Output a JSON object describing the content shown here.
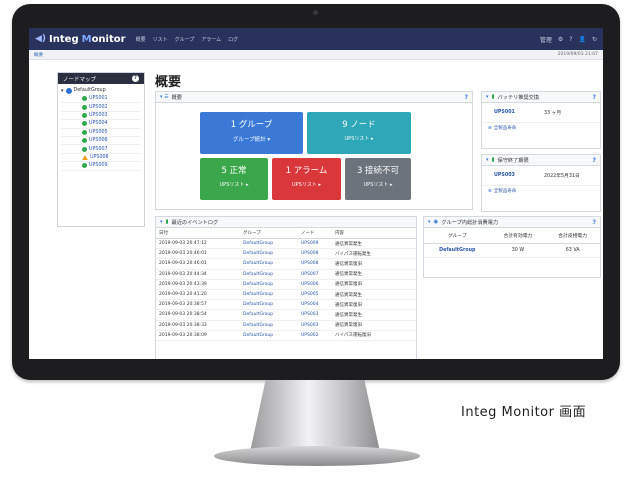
{
  "app": {
    "brand_prefix": "Integ ",
    "brand_m": "M",
    "brand_rest": "onitor"
  },
  "menu": [
    "概要",
    "リスト",
    "グループ",
    "アラーム",
    "ログ"
  ],
  "tools": [
    "管理",
    "⚙",
    "?",
    "👤",
    "↻"
  ],
  "breadcrumb": {
    "label": "概要",
    "timestamp": "2019/09/03 21:07"
  },
  "sidebar": {
    "title": "ノードマップ",
    "root": "DefaultGroup",
    "nodes": [
      {
        "name": "UPS001",
        "status": "ok"
      },
      {
        "name": "UPS002",
        "status": "ok"
      },
      {
        "name": "UPS003",
        "status": "ok"
      },
      {
        "name": "UPS004",
        "status": "ok"
      },
      {
        "name": "UPS005",
        "status": "ok"
      },
      {
        "name": "UPS006",
        "status": "ok"
      },
      {
        "name": "UPS007",
        "status": "ok"
      },
      {
        "name": "UPS008",
        "status": "warn"
      },
      {
        "name": "UPS009",
        "status": "ok"
      }
    ]
  },
  "page_title": "概要",
  "overview": {
    "title": "概要",
    "tiles": {
      "group": {
        "big": "1 グループ",
        "sub": "グループ統計 ▾",
        "color": "#3a7ad6"
      },
      "node": {
        "big": "9 ノード",
        "sub": "UPSリスト ▸",
        "color": "#2ea7b8"
      },
      "normal": {
        "big": "5 正常",
        "sub": "UPSリスト ▸",
        "color": "#3aa84a"
      },
      "alarm": {
        "big": "1 アラーム",
        "sub": "UPSリスト ▸",
        "color": "#d9373a"
      },
      "unknown": {
        "big": "3 接続不可",
        "sub": "UPSリスト ▸",
        "color": "#6d737b"
      }
    }
  },
  "battery": {
    "title": "バッテリ推奨交換",
    "key": "UPS001",
    "value": "33 ヶ月",
    "link": "全製品寿命"
  },
  "warranty": {
    "title": "保守終了期限",
    "key": "UPS003",
    "value": "2022年5月31日",
    "link": "全製品寿命"
  },
  "events": {
    "title": "最近のイベントログ",
    "headers": [
      "日付",
      "グループ",
      "ノード",
      "内容"
    ],
    "rows": [
      [
        "2019-09-03 20:47:12",
        "DefaultGroup",
        "UPS009",
        "通信異常発生"
      ],
      [
        "2019-09-03 20:46:01",
        "DefaultGroup",
        "UPS008",
        "バイパス運転発生"
      ],
      [
        "2019-09-03 20:46:01",
        "DefaultGroup",
        "UPS008",
        "通信異常復旧"
      ],
      [
        "2019-09-03 20:44:34",
        "DefaultGroup",
        "UPS007",
        "通信異常発生"
      ],
      [
        "2019-09-03 20:43:39",
        "DefaultGroup",
        "UPS006",
        "通信異常復旧"
      ],
      [
        "2019-09-03 20:41:20",
        "DefaultGroup",
        "UPS005",
        "通信異常発生"
      ],
      [
        "2019-09-03 20:38:57",
        "DefaultGroup",
        "UPS004",
        "通信異常復旧"
      ],
      [
        "2019-09-03 20:38:54",
        "DefaultGroup",
        "UPS003",
        "通信異常発生"
      ],
      [
        "2019-09-03 20:38:33",
        "DefaultGroup",
        "UPS003",
        "通信異常復旧"
      ],
      [
        "2019-09-03 20:38:09",
        "DefaultGroup",
        "UPS002",
        "バイパス運転復旧"
      ]
    ]
  },
  "power": {
    "title": "グループ内総計消費電力",
    "headers": [
      "グループ",
      "合計有効電力",
      "合計皮相電力"
    ],
    "rows": [
      [
        "DefaultGroup",
        "30 W",
        "63 VA"
      ]
    ]
  },
  "caption": "Integ Monitor 画面"
}
